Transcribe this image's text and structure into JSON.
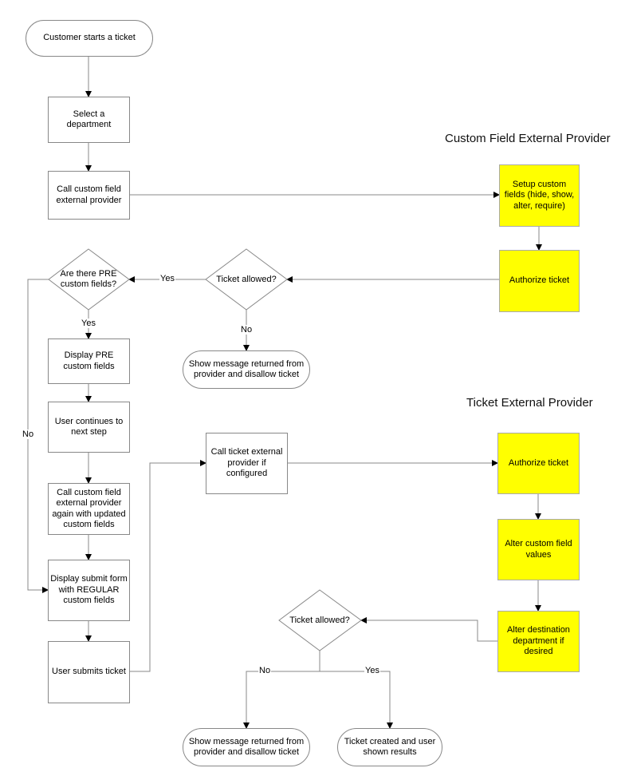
{
  "titles": {
    "custom_field_provider": "Custom Field External Provider",
    "ticket_provider": "Ticket External Provider"
  },
  "nodes": {
    "start": "Customer starts a ticket",
    "select_department": "Select a department",
    "call_cf_provider": "Call custom field external provider",
    "pre_fields_decision": "Are there PRE custom fields?",
    "ticket_allowed_1": "Ticket allowed?",
    "disallow_1": "Show message returned from provider and disallow ticket",
    "display_pre": "Display PRE custom fields",
    "user_continues": "User continues to next step",
    "call_cf_again": "Call custom field external provider again with updated custom fields",
    "display_submit": "Display submit form with REGULAR custom fields",
    "user_submits": "User submits ticket",
    "call_ticket_provider": "Call ticket external provider if configured",
    "setup_custom_fields": "Setup custom fields (hide, show, alter, require)",
    "authorize_ticket_cf": "Authorize ticket",
    "authorize_ticket_tp": "Authorize ticket",
    "alter_cf_values": "Alter custom field values",
    "alter_destination": "Alter destination department if desired",
    "ticket_allowed_2": "Ticket allowed?",
    "disallow_2": "Show message returned from provider and disallow ticket",
    "ticket_created": "Ticket created and user shown results"
  },
  "edge_labels": {
    "yes_allowed_1": "Yes",
    "no_allowed_1": "No",
    "yes_pre": "Yes",
    "no_pre": "No",
    "no_allowed_2": "No",
    "yes_allowed_2": "Yes"
  },
  "colors": {
    "provider_fill": "#ffff00",
    "line": "#888888"
  }
}
